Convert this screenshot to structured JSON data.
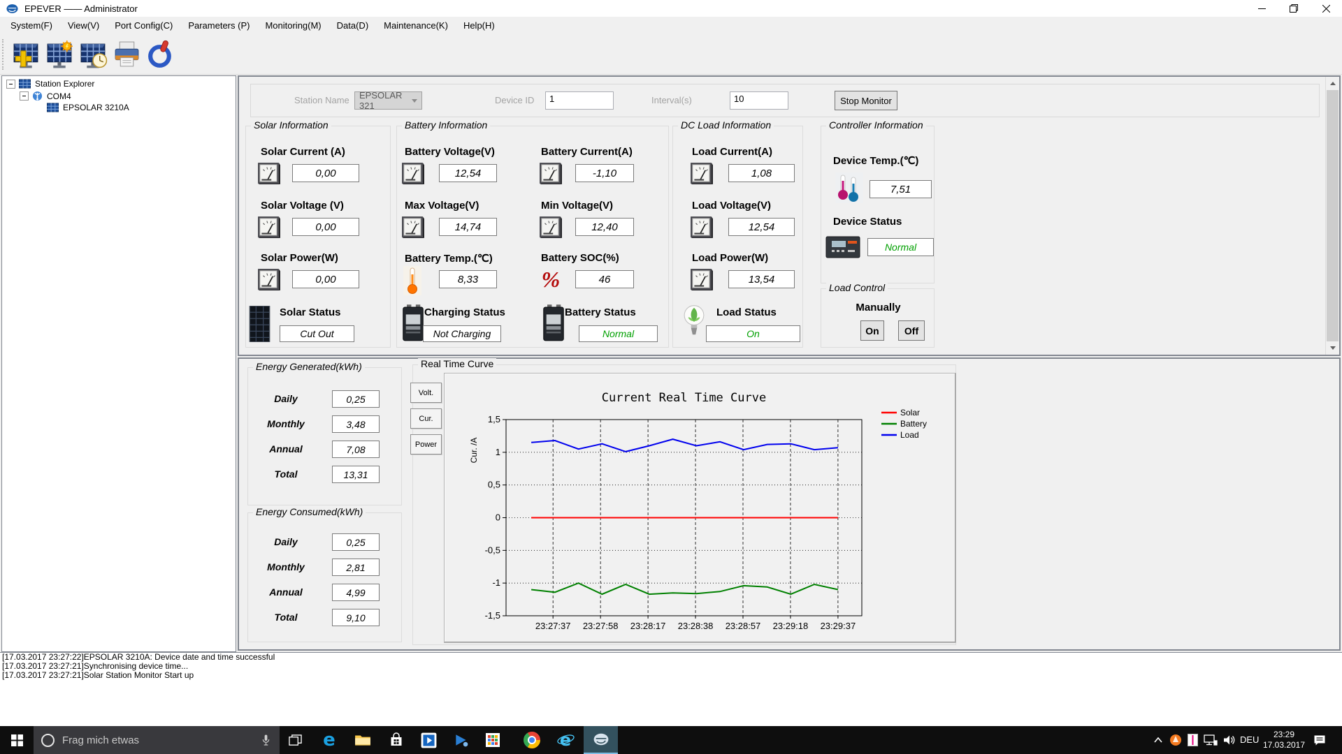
{
  "window": {
    "title": "EPEVER —— Administrator"
  },
  "menu": {
    "items": [
      "System(F)",
      "View(V)",
      "Port Config(C)",
      "Parameters (P)",
      "Monitoring(M)",
      "Data(D)",
      "Maintenance(K)",
      "Help(H)"
    ]
  },
  "tree": {
    "root": "Station Explorer",
    "port": "COM4",
    "device": "EPSOLAR 3210A"
  },
  "station_bar": {
    "station_name_label": "Station Name",
    "station_name_value": "EPSOLAR 321",
    "device_id_label": "Device ID",
    "device_id_value": "1",
    "interval_label": "Interval(s)",
    "interval_value": "10",
    "stop_button": "Stop Monitor"
  },
  "solar": {
    "title": "Solar Information",
    "current_label": "Solar Current (A)",
    "current": "0,00",
    "voltage_label": "Solar Voltage (V)",
    "voltage": "0,00",
    "power_label": "Solar Power(W)",
    "power": "0,00",
    "status_label": "Solar Status",
    "status": "Cut Out"
  },
  "battery": {
    "title": "Battery Information",
    "voltage_label": "Battery Voltage(V)",
    "voltage": "12,54",
    "current_label": "Battery Current(A)",
    "current": "-1,10",
    "max_voltage_label": "Max Voltage(V)",
    "max_voltage": "14,74",
    "min_voltage_label": "Min Voltage(V)",
    "min_voltage": "12,40",
    "temp_label": "Battery Temp.(℃)",
    "temp": "8,33",
    "soc_label": "Battery SOC(%)",
    "soc": "46",
    "charging_label": "Charging Status",
    "charging_status": "Not Charging",
    "status_label": "Battery Status",
    "status": "Normal"
  },
  "dc_load": {
    "title": "DC Load Information",
    "current_label": "Load Current(A)",
    "current": "1,08",
    "voltage_label": "Load Voltage(V)",
    "voltage": "12,54",
    "power_label": "Load Power(W)",
    "power": "13,54",
    "status_label": "Load Status",
    "status": "On"
  },
  "controller": {
    "title": "Controller Information",
    "temp_label": "Device Temp.(℃)",
    "temp": "7,51",
    "status_label": "Device Status",
    "status": "Normal"
  },
  "load_control": {
    "title": "Load Control",
    "manually_label": "Manually",
    "on_button": "On",
    "off_button": "Off"
  },
  "energy_generated": {
    "title": "Energy Generated(kWh)",
    "rows": [
      {
        "label": "Daily",
        "value": "0,25"
      },
      {
        "label": "Monthly",
        "value": "3,48"
      },
      {
        "label": "Annual",
        "value": "7,08"
      },
      {
        "label": "Total",
        "value": "13,31"
      }
    ]
  },
  "energy_consumed": {
    "title": "Energy Consumed(kWh)",
    "rows": [
      {
        "label": "Daily",
        "value": "0,25"
      },
      {
        "label": "Monthly",
        "value": "2,81"
      },
      {
        "label": "Annual",
        "value": "4,99"
      },
      {
        "label": "Total",
        "value": "9,10"
      }
    ]
  },
  "curve_panel": {
    "title": "Real Time Curve",
    "tabs": [
      "Volt.",
      "Cur.",
      "Power"
    ]
  },
  "chart_data": {
    "type": "line",
    "title": "Current Real Time Curve",
    "xlabel": "",
    "ylabel": "Cur. /A",
    "ylim": [
      -1.5,
      1.5
    ],
    "grid": true,
    "legend_position": "right",
    "yticks": [
      {
        "v": 1.5,
        "label": "1,5"
      },
      {
        "v": 1.0,
        "label": "1"
      },
      {
        "v": 0.5,
        "label": "0,5"
      },
      {
        "v": 0.0,
        "label": "0"
      },
      {
        "v": -0.5,
        "label": "-0,5"
      },
      {
        "v": -1.0,
        "label": "-1"
      },
      {
        "v": -1.5,
        "label": "-1,5"
      }
    ],
    "x_tick_labels": [
      "23:27:37",
      "23:27:58",
      "23:28:17",
      "23:28:38",
      "23:28:57",
      "23:29:18",
      "23:29:37"
    ],
    "series": [
      {
        "name": "Solar",
        "color": "#ff0000",
        "values": [
          0,
          0,
          0,
          0,
          0,
          0,
          0,
          0,
          0,
          0,
          0,
          0,
          0,
          0
        ]
      },
      {
        "name": "Battery",
        "color": "#008000",
        "values": [
          -1.1,
          -1.14,
          -1.0,
          -1.17,
          -1.02,
          -1.17,
          -1.15,
          -1.16,
          -1.13,
          -1.04,
          -1.06,
          -1.17,
          -1.02,
          -1.1
        ]
      },
      {
        "name": "Load",
        "color": "#0000ee",
        "values": [
          1.15,
          1.18,
          1.05,
          1.13,
          1.01,
          1.1,
          1.2,
          1.1,
          1.16,
          1.04,
          1.12,
          1.13,
          1.04,
          1.07
        ]
      }
    ]
  },
  "log": {
    "lines": [
      "[17.03.2017 23:27:22]EPSOLAR 3210A: Device date and time successful",
      "[17.03.2017 23:27:21]Synchronising device time...",
      "[17.03.2017 23:27:21]Solar Station Monitor Start up"
    ]
  },
  "taskbar": {
    "search_placeholder": "Frag mich etwas",
    "language": "DEU",
    "time": "23:29",
    "date": "17.03.2017"
  }
}
